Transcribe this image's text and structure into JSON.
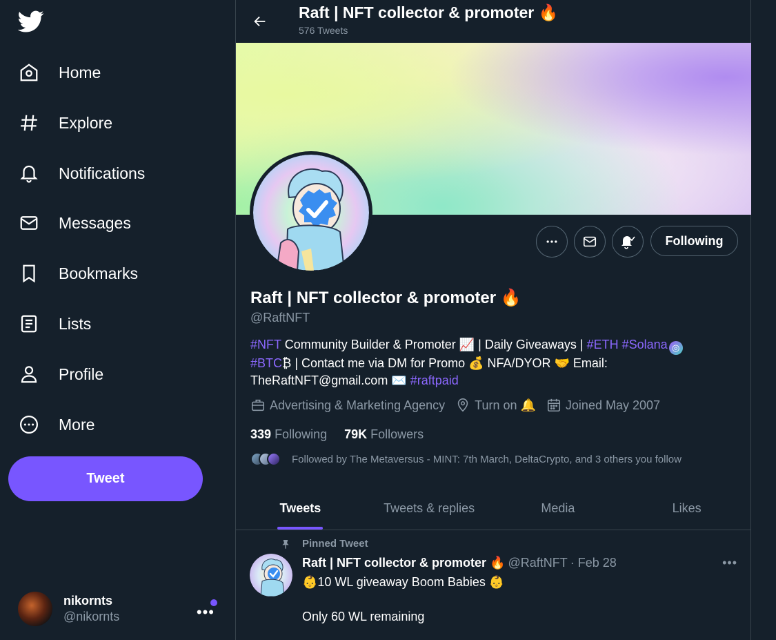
{
  "sidebar": {
    "logo": "twitter-bird-icon",
    "nav": [
      {
        "label": "Home",
        "icon": "home-icon"
      },
      {
        "label": "Explore",
        "icon": "hashtag-icon"
      },
      {
        "label": "Notifications",
        "icon": "bell-icon"
      },
      {
        "label": "Messages",
        "icon": "envelope-icon"
      },
      {
        "label": "Bookmarks",
        "icon": "bookmark-icon"
      },
      {
        "label": "Lists",
        "icon": "list-icon"
      },
      {
        "label": "Profile",
        "icon": "person-icon"
      },
      {
        "label": "More",
        "icon": "more-circle-icon"
      }
    ],
    "tweet_label": "Tweet",
    "account": {
      "name": "nikornts",
      "handle": "@nikornts",
      "more": "•••"
    }
  },
  "header": {
    "title": "Raft | NFT collector & promoter 🔥",
    "tweet_count": "576 Tweets"
  },
  "profile": {
    "name": "Raft | NFT collector & promoter 🔥",
    "handle": "@RaftNFT",
    "following_label": "Following",
    "bio": {
      "tag_nft": "#NFT",
      "text1": " Community Builder & Promoter 📈 | Daily Giveaways | ",
      "tag_eth": "#ETH",
      "tag_solana": "#Solana",
      "solana_glyph": "◎",
      "tag_btc": "#BTC",
      "text2": "₿  | Contact me via DM for Promo 💰 NFA/DYOR 🤝 Email: TheRaftNFT@gmail.com ✉️ ",
      "tag_raftpaid": "#raftpaid"
    },
    "category": "Advertising & Marketing Agency",
    "location": "Turn on 🔔",
    "joined": "Joined May 2007",
    "following_count": "339",
    "following_text": "Following",
    "followers_count": "79K",
    "followers_text": "Followers",
    "followed_by": "Followed by The Metaversus - MINT: 7th March, DeltaCrypto, and 3 others you follow"
  },
  "tabs": [
    "Tweets",
    "Tweets & replies",
    "Media",
    "Likes"
  ],
  "pinned_tweet": {
    "pinned_label": "Pinned Tweet",
    "name": "Raft | NFT collector & promoter 🔥",
    "handle": "@RaftNFT",
    "date": "· Feb 28",
    "more": "•••",
    "line1": "👶10 WL giveaway Boom Babies 👶",
    "line2": "Only 60 WL remaining"
  },
  "colors": {
    "background": "#15202b",
    "accent": "#7856ff",
    "muted": "#8b98a5",
    "border": "#38444d"
  }
}
